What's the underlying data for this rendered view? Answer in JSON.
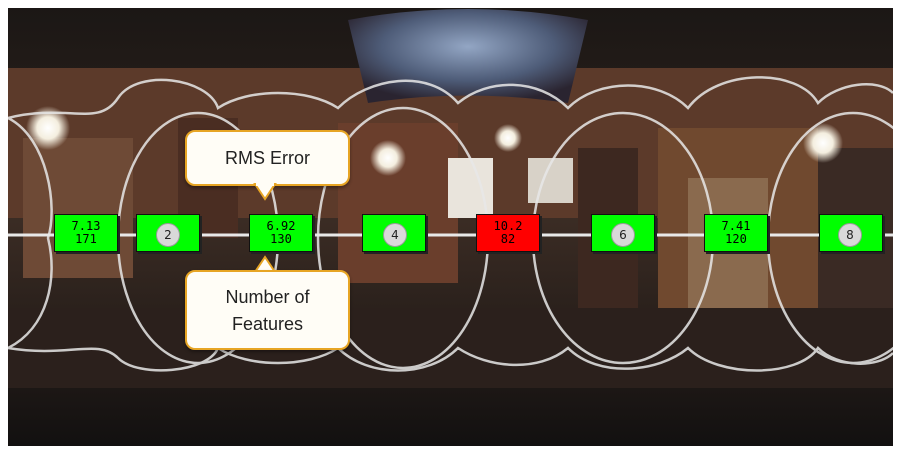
{
  "scene": {
    "description_colors": {
      "ok": "#00ff00",
      "error": "#ff0000",
      "callout_border": "#e7a524",
      "callout_fill": "#fffdf6"
    }
  },
  "callouts": {
    "rms_error": "RMS Error",
    "num_features_line1": "Number of",
    "num_features_line2": "Features"
  },
  "markers": [
    {
      "rms": "7.13",
      "features": "171",
      "status": "ok"
    },
    {
      "rms": "",
      "features": "",
      "status": "ok"
    },
    {
      "rms": "6.92",
      "features": "130",
      "status": "ok"
    },
    {
      "rms": "",
      "features": "",
      "status": "ok"
    },
    {
      "rms": "10.2",
      "features": "82",
      "status": "error"
    },
    {
      "rms": "",
      "features": "",
      "status": "ok"
    },
    {
      "rms": "7.41",
      "features": "120",
      "status": "ok"
    },
    {
      "rms": "",
      "features": "",
      "status": "ok"
    }
  ],
  "nodes": [
    "2",
    "4",
    "6",
    "8"
  ]
}
